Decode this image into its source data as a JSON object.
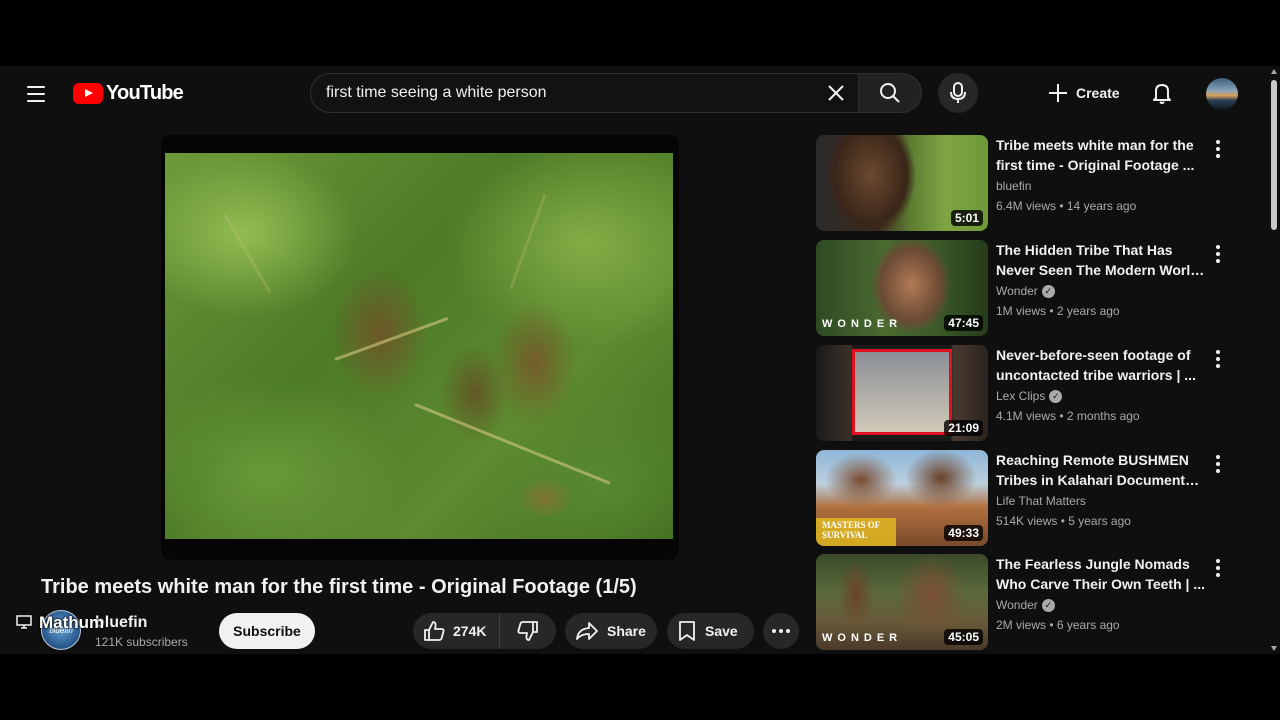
{
  "header": {
    "logo_text": "YouTube",
    "search_value": "first time seeing a white person",
    "create_label": "Create"
  },
  "video": {
    "title": "Tribe meets white man for the first time - Original Footage (1/5)",
    "channel_name": "bluefin",
    "channel_avatar_text": "bluefin",
    "overlay_name": "Mathum",
    "subscribers": "121K subscribers",
    "subscribe_label": "Subscribe",
    "like_count": "274K",
    "share_label": "Share",
    "save_label": "Save"
  },
  "recommendations": [
    {
      "title_line1": "Tribe meets white man for the",
      "title_line2": "first time - Original Footage ...",
      "channel": "bluefin",
      "verified": false,
      "meta": "6.4M views • 14 years ago",
      "duration": "5:01"
    },
    {
      "title_line1": "The Hidden Tribe That Has",
      "title_line2": "Never Seen The Modern World...",
      "channel": "Wonder",
      "verified": true,
      "meta": "1M views • 2 years ago",
      "duration": "47:45",
      "watermark": "WONDER"
    },
    {
      "title_line1": "Never-before-seen footage of",
      "title_line2": "uncontacted tribe warriors | ...",
      "channel": "Lex Clips",
      "verified": true,
      "meta": "4.1M views • 2 months ago",
      "duration": "21:09"
    },
    {
      "title_line1": "Reaching Remote BUSHMEN",
      "title_line2": "Tribes in Kalahari Documentar...",
      "channel": "Life That Matters",
      "verified": false,
      "meta": "514K views • 5 years ago",
      "duration": "49:33",
      "watermark": "MASTERS OF SURVIVAL"
    },
    {
      "title_line1": "The Fearless Jungle Nomads",
      "title_line2": "Who Carve Their Own Teeth | ...",
      "channel": "Wonder",
      "verified": true,
      "meta": "2M views • 6 years ago",
      "duration": "45:05",
      "watermark": "WONDER"
    }
  ],
  "colors": {
    "background": "#0f0f0f",
    "logo_red": "#ff0000",
    "text_primary": "#f1f1f1",
    "text_secondary": "#aaaaaa",
    "chip": "#272727"
  },
  "icons": [
    "menu-icon",
    "youtube-logo-icon",
    "clear-icon",
    "search-icon",
    "mic-icon",
    "plus-icon",
    "bell-icon",
    "cast-icon",
    "thumbs-up-icon",
    "thumbs-down-icon",
    "share-icon",
    "bookmark-icon",
    "more-horizontal-icon",
    "more-vertical-icon",
    "verified-icon"
  ]
}
